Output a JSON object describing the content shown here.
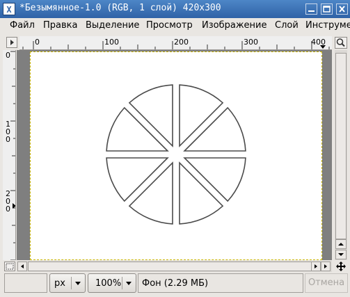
{
  "window": {
    "app_icon": "X",
    "title": "*Безымянное-1.0 (RGB, 1 слой) 420x300"
  },
  "menu": [
    {
      "label": "Файл"
    },
    {
      "label": "Правка"
    },
    {
      "label": "Выделение"
    },
    {
      "label": "Просмотр"
    },
    {
      "label": "Изображение"
    },
    {
      "label": "Слой"
    },
    {
      "label": "Инструме"
    }
  ],
  "ruler": {
    "h_labels": [
      "0",
      "100",
      "200",
      "300",
      "400"
    ],
    "v_labels": [
      {
        "digits": [
          "0"
        ]
      },
      {
        "digits": [
          "1",
          "0",
          "0"
        ]
      },
      {
        "digits": [
          "2",
          "0",
          "0"
        ]
      }
    ]
  },
  "icons": {
    "menu_corner": "triangle-right-icon",
    "zoom": "magnifier-icon",
    "quick_mask": "quick-mask-icon",
    "navigate": "move-cross-icon",
    "window_min": "minimize-icon",
    "window_max": "maximize-icon",
    "window_close": "close-icon"
  },
  "canvas": {
    "image_size": "420x300",
    "background": "#ffffff",
    "drawing": "circle divided into 8 sectors, outlined"
  },
  "status": {
    "unit": "px",
    "zoom": "100%",
    "info": "Фон (2.29 МБ)",
    "cancel_label": "Отмена"
  },
  "colors": {
    "titlebar": "#3a6fb4",
    "selection_border": "#c8b400",
    "canvas_bg": "#7f7f7f"
  }
}
